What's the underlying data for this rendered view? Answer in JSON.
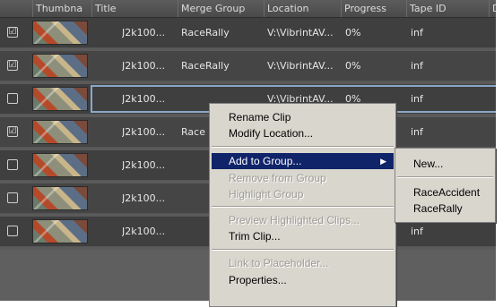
{
  "columns": {
    "thumbnail": "Thumbna",
    "title": "Title",
    "merge_group": "Merge Group",
    "location": "Location",
    "progress": "Progress",
    "tape_id": "Tape ID",
    "extra": "D"
  },
  "rows": [
    {
      "checked": true,
      "check_glyph": "☑",
      "title": "J2k100...",
      "group": "RaceRally",
      "location": "V:\\VibrintAV...",
      "progress": "0%",
      "tape": "inf"
    },
    {
      "checked": true,
      "check_glyph": "☑",
      "title": "J2k100...",
      "group": "RaceRally",
      "location": "V:\\VibrintAV...",
      "progress": "0%",
      "tape": "inf"
    },
    {
      "checked": false,
      "check_glyph": "",
      "title": "J2k100...",
      "group": "",
      "location": "V:\\VibrintAV...",
      "progress": "0%",
      "tape": "inf"
    },
    {
      "checked": true,
      "check_glyph": "☑",
      "title": "J2k100...",
      "group": "Race",
      "location": "",
      "progress": "",
      "tape": "inf"
    },
    {
      "checked": false,
      "check_glyph": "",
      "title": "J2k100...",
      "group": "",
      "location": "",
      "progress": "",
      "tape": "inf"
    },
    {
      "checked": false,
      "check_glyph": "",
      "title": "J2k100...",
      "group": "",
      "location": "",
      "progress": "",
      "tape": "inf"
    },
    {
      "checked": false,
      "check_glyph": "",
      "title": "J2k100...",
      "group": "",
      "location": "",
      "progress": "",
      "tape": "inf"
    }
  ],
  "context_menu": {
    "rename_clip": "Rename Clip",
    "modify_location": "Modify Location...",
    "add_to_group": "Add to Group...",
    "remove_from_group": "Remove from Group",
    "highlight_group": "Highlight Group",
    "preview_highlighted": "Preview Highlighted Clips...",
    "trim_clip": "Trim Clip...",
    "link_to_placeholder": "Link to Placeholder...",
    "properties": "Properties...",
    "arrow": "▶"
  },
  "submenu": {
    "new": "New...",
    "groups": [
      "RaceAccident",
      "RaceRally"
    ]
  },
  "colors": {
    "menu_highlight": "#10246a",
    "row_bg": "#3f3f3f",
    "selection_border": "#8aa9c9"
  }
}
